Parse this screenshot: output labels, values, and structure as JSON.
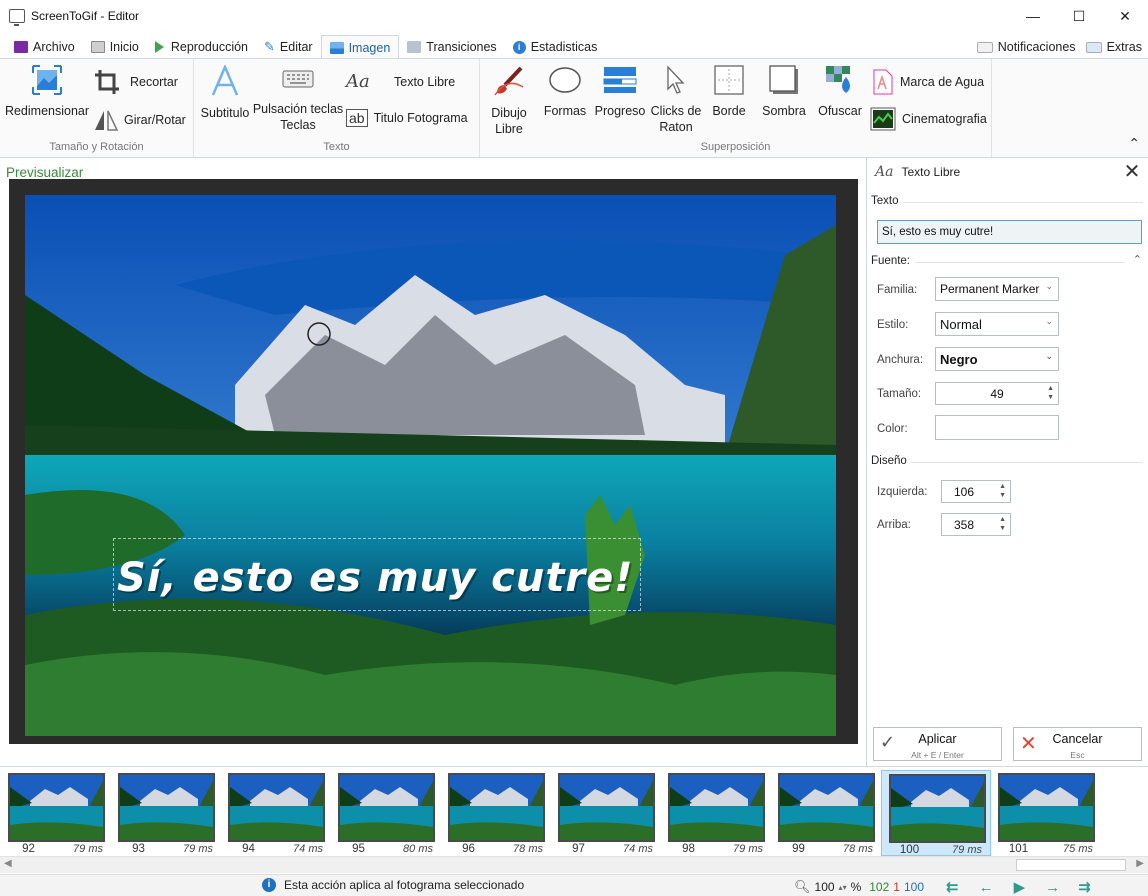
{
  "window": {
    "title": "ScreenToGif - Editor",
    "minimize": "—",
    "maximize": "☐",
    "close": "✕"
  },
  "tabs": [
    {
      "label": "Archivo",
      "color": "#7b2aa3"
    },
    {
      "label": "Inicio",
      "color": "#8a8a8a"
    },
    {
      "label": "Reproducción",
      "color": "#3aa84a"
    },
    {
      "label": "Editar",
      "color": "#2a7ed6"
    },
    {
      "label": "Imagen",
      "color": "#2a7ed6"
    },
    {
      "label": "Transiciones",
      "color": "#8a96a4"
    },
    {
      "label": "Estadisticas",
      "color": "#2a7ed6"
    }
  ],
  "active_tab": "Imagen",
  "tabs_right": {
    "notifications": "Notificaciones",
    "extras": "Extras"
  },
  "ribbon": {
    "size_group": {
      "label": "Tamaño y Rotación",
      "resize": "Redimensionar",
      "crop": "Recortar",
      "rotate": "Girar/Rotar"
    },
    "text_group": {
      "label": "Texto",
      "subtitle": "Subtitulo",
      "keystrokes_1": "Pulsación teclas",
      "keystrokes_2": "Teclas",
      "free_text": "Texto Libre",
      "frame_title": "Titulo Fotograma"
    },
    "overlay_group": {
      "label": "Superposición",
      "draw_1": "Dibujo",
      "draw_2": "Libre",
      "shapes": "Formas",
      "progress": "Progreso",
      "clicks_1": "Clicks de",
      "clicks_2": "Raton",
      "border": "Borde",
      "shadow": "Sombra",
      "obfuscate": "Ofuscar",
      "watermark": "Marca de Agua",
      "cinemagraph": "Cinematografia"
    },
    "collapse": "⌃"
  },
  "preview": {
    "label": "Previsualizar",
    "overlay_text": "Sí, esto es muy cutre!"
  },
  "panel": {
    "title": "Texto Libre",
    "title_icon": "Aa",
    "close": "✕",
    "text_section": "Texto",
    "text_value": "Sí, esto es muy cutre!",
    "font_section": "Fuente:",
    "family_label": "Familia:",
    "family_value": "Permanent Marker",
    "style_label": "Estilo:",
    "style_value": "Normal",
    "weight_label": "Anchura:",
    "weight_value": "Negro",
    "size_label": "Tamaño:",
    "size_value": "49",
    "color_label": "Color:",
    "color_value": "#ffffff",
    "layout_section": "Diseño",
    "left_label": "Izquierda:",
    "left_value": "106",
    "top_label": "Arriba:",
    "top_value": "358",
    "apply_label": "Aplicar",
    "apply_shortcut": "Alt + E / Enter",
    "cancel_label": "Cancelar",
    "cancel_shortcut": "Esc"
  },
  "frames": [
    {
      "number": "92",
      "delay": "79 ms"
    },
    {
      "number": "93",
      "delay": "79 ms"
    },
    {
      "number": "94",
      "delay": "74 ms"
    },
    {
      "number": "95",
      "delay": "80 ms"
    },
    {
      "number": "96",
      "delay": "78 ms"
    },
    {
      "number": "97",
      "delay": "74 ms"
    },
    {
      "number": "98",
      "delay": "79 ms"
    },
    {
      "number": "99",
      "delay": "78 ms"
    },
    {
      "number": "100",
      "delay": "79 ms"
    },
    {
      "number": "101",
      "delay": "75 ms"
    }
  ],
  "selected_frame": "100",
  "status": {
    "message": "Esta acción aplica al fotograma seleccionado",
    "zoom": "100",
    "zoom_unit": "%",
    "total_frames": "102",
    "selected_count": "1",
    "current_frame": "100"
  }
}
